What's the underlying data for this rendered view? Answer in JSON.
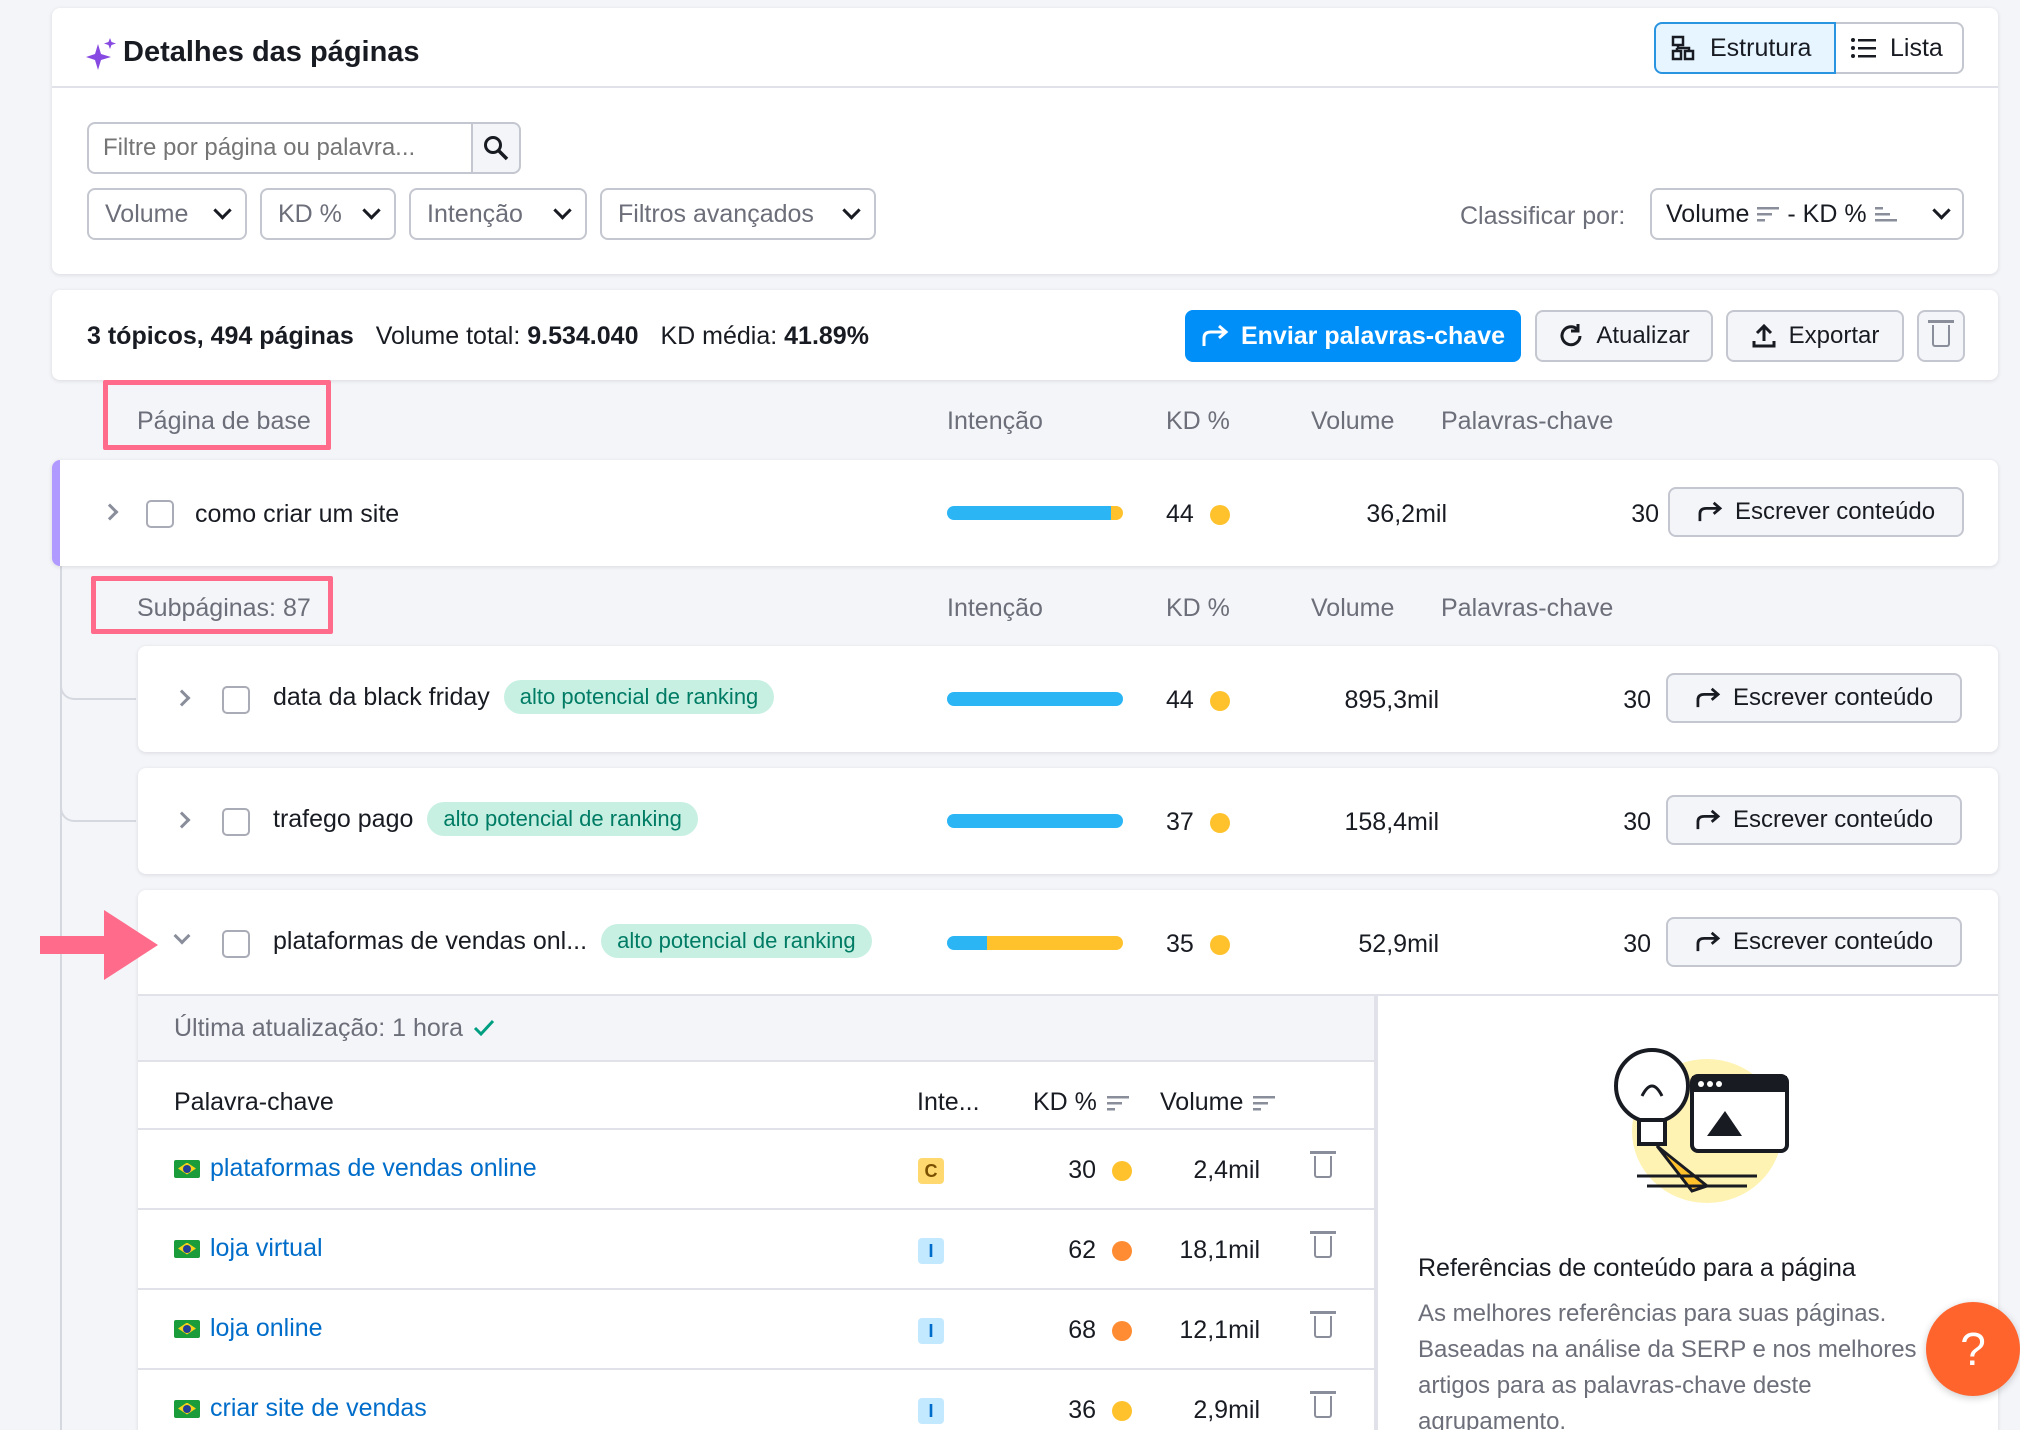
{
  "header": {
    "title": "Detalhes das páginas",
    "view_structure": "Estrutura",
    "view_list": "Lista"
  },
  "filters": {
    "search_placeholder": "Filtre por página ou palavra...",
    "volume": "Volume",
    "kd": "KD %",
    "intent": "Intenção",
    "advanced": "Filtros avançados",
    "sort_label": "Classificar por:",
    "sort_volume": "Volume",
    "sort_sep": "- KD %"
  },
  "summary": {
    "topics_pages": "3 tópicos, 494 páginas",
    "total_volume_label": "Volume total:",
    "total_volume_value": "9.534.040",
    "kd_avg_label": "KD média:",
    "kd_avg_value": "41.89%",
    "send_keywords": "Enviar palavras-chave",
    "refresh": "Atualizar",
    "export": "Exportar"
  },
  "columns": {
    "base_page": "Página de base",
    "subpages": "Subpáginas: 87",
    "intent": "Intenção",
    "kd": "KD %",
    "volume": "Volume",
    "keywords": "Palavras-chave"
  },
  "colors": {
    "blue": "#2bb5f5",
    "yellow": "#ffc22d",
    "orange": "#ff8c33",
    "accent": "#006dca",
    "pink": "#ff6b8b"
  },
  "base_row": {
    "name": "como criar um site",
    "intent_split": [
      0.93,
      0.07
    ],
    "kd": "44",
    "kd_color": "#ffc22d",
    "volume": "36,2mil",
    "keywords": "30",
    "write": "Escrever conteúdo"
  },
  "subrows": [
    {
      "name": "data da black friday",
      "tag": "alto potencial de ranking",
      "intent_split": [
        1.0,
        0.0
      ],
      "kd": "44",
      "kd_color": "#ffc22d",
      "volume": "895,3mil",
      "keywords": "30",
      "write": "Escrever conteúdo"
    },
    {
      "name": "trafego pago",
      "tag": "alto potencial de ranking",
      "intent_split": [
        1.0,
        0.0
      ],
      "kd": "37",
      "kd_color": "#ffc22d",
      "volume": "158,4mil",
      "keywords": "30",
      "write": "Escrever conteúdo"
    },
    {
      "name": "plataformas de vendas onl...",
      "tag": "alto potencial de ranking",
      "intent_split": [
        0.23,
        0.77
      ],
      "kd": "35",
      "kd_color": "#ffc22d",
      "volume": "52,9mil",
      "keywords": "30",
      "write": "Escrever conteúdo"
    }
  ],
  "expanded": {
    "last_update": "Última atualização: 1 hora",
    "col_keyword": "Palavra-chave",
    "col_intent": "Inte...",
    "col_kd": "KD %",
    "col_volume": "Volume",
    "keywords": [
      {
        "text": "plataformas de vendas online",
        "intent": "C",
        "intent_bg": "#ffd970",
        "intent_fg": "#7a4f00",
        "kd": "30",
        "kd_color": "#ffc22d",
        "volume": "2,4mil"
      },
      {
        "text": "loja virtual",
        "intent": "I",
        "intent_bg": "#c2e9ff",
        "intent_fg": "#006dca",
        "kd": "62",
        "kd_color": "#ff8c33",
        "volume": "18,1mil"
      },
      {
        "text": "loja online",
        "intent": "I",
        "intent_bg": "#c2e9ff",
        "intent_fg": "#006dca",
        "kd": "68",
        "kd_color": "#ff8c33",
        "volume": "12,1mil"
      },
      {
        "text": "criar site de vendas",
        "intent": "I",
        "intent_bg": "#c2e9ff",
        "intent_fg": "#006dca",
        "kd": "36",
        "kd_color": "#ffc22d",
        "volume": "2,9mil"
      }
    ],
    "side_title": "Referências de conteúdo para a página",
    "side_text": "As melhores referências para suas páginas. Baseadas na análise da SERP e nos melhores artigos para as palavras-chave deste agrupamento."
  },
  "help": "?"
}
